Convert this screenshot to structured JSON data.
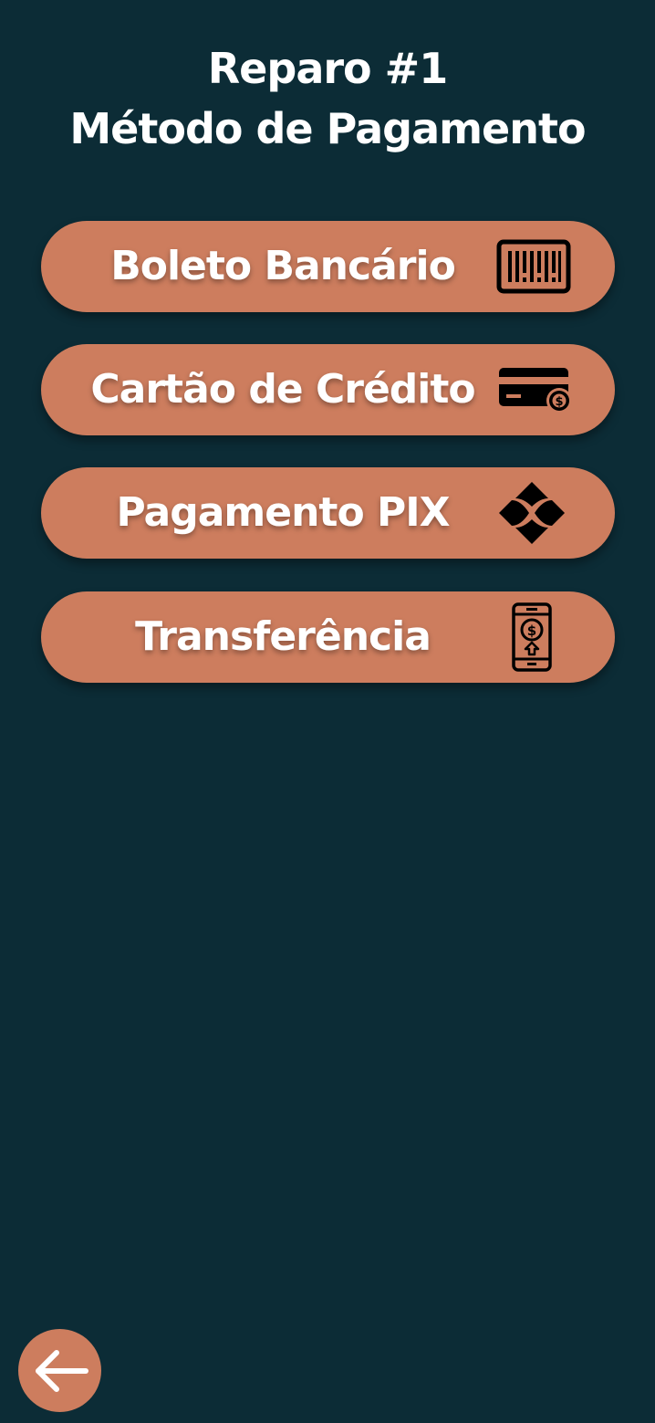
{
  "header": {
    "title": "Reparo #1",
    "subtitle": "Método de Pagamento"
  },
  "options": [
    {
      "label": "Boleto Bancário",
      "icon": "barcode-icon"
    },
    {
      "label": "Cartão de Crédito",
      "icon": "credit-card-icon"
    },
    {
      "label": "Pagamento PIX",
      "icon": "pix-icon"
    },
    {
      "label": "Transferência",
      "icon": "phone-transfer-icon"
    }
  ],
  "back_button": {
    "icon": "arrow-left-icon"
  },
  "colors": {
    "background": "#0c2c36",
    "button": "#cd7d5e",
    "text": "#ffffff"
  }
}
